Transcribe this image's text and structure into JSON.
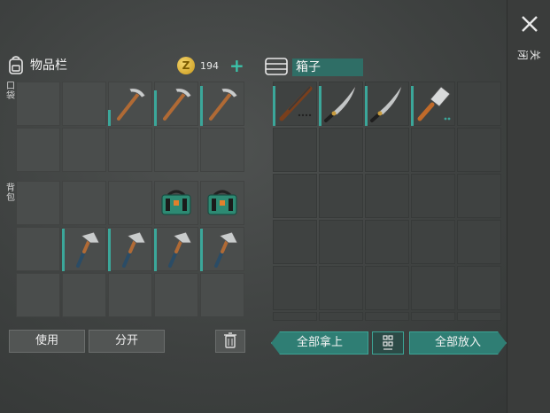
{
  "inventory": {
    "title": "物品栏",
    "icon": "backpack-icon",
    "pocket_label": "口袋",
    "backpack_label": "背包",
    "coins": "194",
    "coin_symbol": "Z",
    "pockets": [
      {
        "item": null
      },
      {
        "item": null
      },
      {
        "item": "pickaxe",
        "durability": 0.35
      },
      {
        "item": "pickaxe",
        "durability": 0.8
      },
      {
        "item": "pickaxe",
        "durability": 0.9
      },
      {
        "item": null
      },
      {
        "item": null
      },
      {
        "item": null
      },
      {
        "item": null
      },
      {
        "item": null
      }
    ],
    "backpack": [
      {
        "item": null
      },
      {
        "item": null
      },
      {
        "item": null
      },
      {
        "item": "toolbox"
      },
      {
        "item": "toolbox"
      },
      {
        "item": null
      },
      {
        "item": "hatchet",
        "durability": 0.95
      },
      {
        "item": "hatchet",
        "durability": 0.95
      },
      {
        "item": "hatchet",
        "durability": 0.95
      },
      {
        "item": "hatchet",
        "durability": 0.95
      },
      {
        "item": null
      },
      {
        "item": null
      },
      {
        "item": null
      },
      {
        "item": null
      },
      {
        "item": null
      }
    ],
    "buttons": {
      "use": "使用",
      "split": "分开"
    }
  },
  "chest": {
    "title": "箱子",
    "icon": "chest-icon",
    "slots": [
      {
        "item": "rifle",
        "durability": 0.9
      },
      {
        "item": "machete",
        "durability": 0.9
      },
      {
        "item": "machete",
        "durability": 0.9
      },
      {
        "item": "cleaver",
        "durability": 0.9
      }
    ],
    "buttons": {
      "take_all": "全部拿上",
      "put_all": "全部放入"
    }
  },
  "sidebar": {
    "close_label": "关闭"
  }
}
